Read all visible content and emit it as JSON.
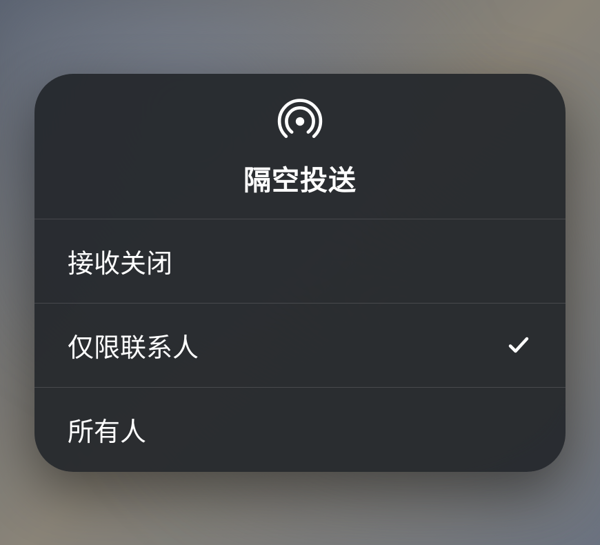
{
  "title": "隔空投送",
  "options": [
    {
      "label": "接收关闭",
      "selected": false
    },
    {
      "label": "仅限联系人",
      "selected": true
    },
    {
      "label": "所有人",
      "selected": false
    }
  ]
}
